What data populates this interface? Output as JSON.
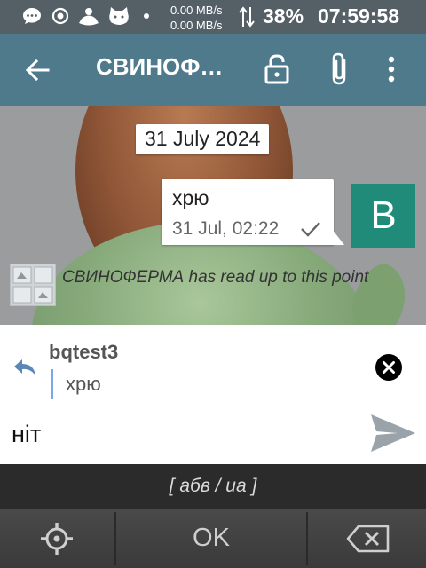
{
  "status_bar": {
    "speed_up": "0.00 MB/s",
    "speed_down": "0.00 MB/s",
    "battery": "38%",
    "time": "07:59:58",
    "icons": [
      "message-icon",
      "record-icon",
      "person-icon",
      "cat-icon"
    ]
  },
  "app_bar": {
    "title": "СВИНОФ…",
    "icons": [
      "back-arrow-icon",
      "unlock-icon",
      "paperclip-icon",
      "more-vertical-icon"
    ],
    "color": "#4f7a8b"
  },
  "chat": {
    "date": "31 July 2024",
    "message": {
      "text": "хрю",
      "time": "31 Jul, 02:22",
      "status_icon": "check-icon"
    },
    "avatar_letter": "B",
    "avatar_color": "#1f8b78",
    "read_marker": "СВИНОФЕРМА has read up to this point"
  },
  "reply": {
    "author": "bqtest3",
    "quote": "хрю",
    "accent": "#7aa7e6"
  },
  "input": {
    "value": "ніт"
  },
  "keyboard": {
    "mode": "[ абв / ua ]"
  },
  "softkeys": {
    "ok_label": "OK"
  }
}
